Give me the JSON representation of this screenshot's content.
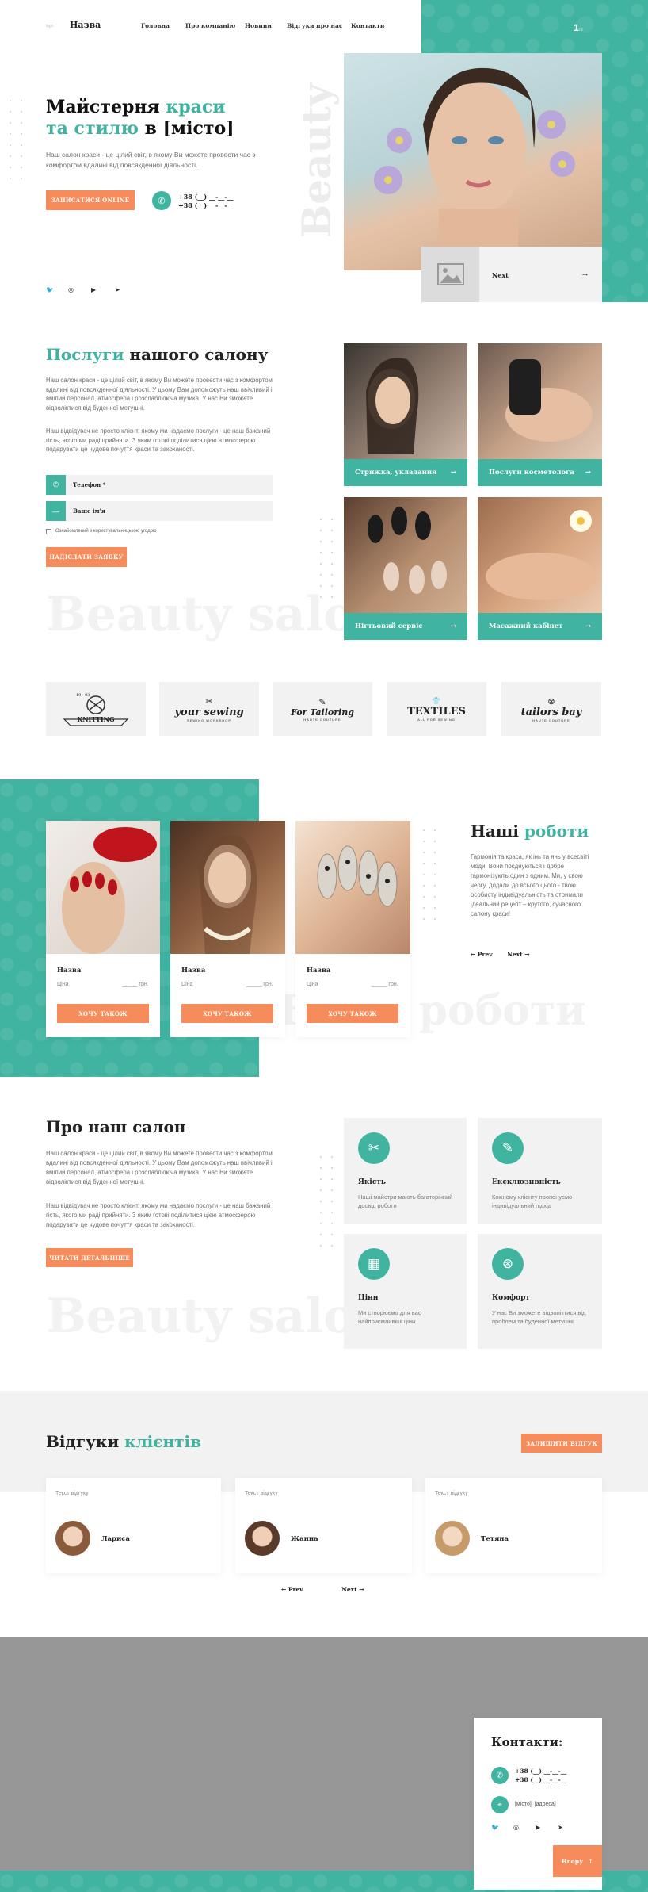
{
  "header": {
    "logo_label": "logo",
    "brand": "Назва",
    "nav": [
      "Головна",
      "Про компанію",
      "Новини",
      "Відгуки про нас",
      "Контакти"
    ],
    "page_indicator": "1",
    "page_indicator_small": "/3"
  },
  "hero": {
    "title_part1": "Майстерня ",
    "title_accent": "краси та стилю",
    "title_part2": " в [місто]",
    "text": "Наш салон краси - це цілий світ, в якому Ви можете провести час з комфортом вдалині від повсякденної діяльності.",
    "cta": "Записатися Online",
    "phone1": "+38 (__) __-__-__",
    "phone2": "+38 (__) __-__-__",
    "vertical_word": "Beauty",
    "next_label": "Next"
  },
  "socials": [
    "twitter-icon",
    "instagram-icon",
    "youtube-icon",
    "telegram-icon"
  ],
  "services": {
    "title_accent": "Послуги",
    "title_rest": " нашого салону",
    "text1": "Наш салон краси - це цілий світ, в якому Ви можете провести час з комфортом вдалині від повсякденної діяльності. У цьому Вам допоможуть наш ввічливий і вмілий персонал, атмосфера і розслаблююча музика. У нас Ви зможете відволіктися від буденної метушні.",
    "text2": "Наш відвідувач не просто клієнт, якому ми надаємо послуги - це наш бажаний гість, якого ми раді прийняти. З яким готові поділитися цією атмосферою подарувати це чудове почуття краси та закоханості.",
    "phone_placeholder": "Телефон *",
    "name_placeholder": "Ваше ім'я",
    "consent": "Ознайомлений з користувальницькою угодою",
    "submit": "Надіслати заявку",
    "ghost": "Beauty saloon",
    "cards": [
      "Стрижка, укладання",
      "Послуги косметолога",
      "Нігтьовий сервіс",
      "Масажний кабінет"
    ]
  },
  "partners": [
    {
      "top": "19 · 93",
      "name": "KNITTING"
    },
    {
      "top": "",
      "name": "your sewing",
      "sub": "SEWING WORKSHOP"
    },
    {
      "top": "",
      "name": "For Tailoring",
      "sub": "HAUTE COUTURE"
    },
    {
      "top": "",
      "name": "TEXTILES",
      "sub": "ALL FOR SEWING"
    },
    {
      "top": "",
      "name": "tailors bay",
      "sub": "HAUTE COUTURE"
    }
  ],
  "works": {
    "title_part1": "Наші ",
    "title_accent": "роботи",
    "text": "Гармонія та краса, як інь та янь у всесвіті моди. Вони поєднуються і добре гармонізують один з одним. Ми, у свою чергу, додали до всього цього - твою особисту індивідуальність та отримали ідеальний рецепт – крутого, сучасного салону краси!",
    "prev": "Prev",
    "next": "Next",
    "ghost": "Наші роботи",
    "items": [
      {
        "name": "Назва",
        "price_label": "Ціна",
        "price": "_____ грн.",
        "cta": "Хочу також"
      },
      {
        "name": "Назва",
        "price_label": "Ціна",
        "price": "_____ грн.",
        "cta": "Хочу також"
      },
      {
        "name": "Назва",
        "price_label": "Ціна",
        "price": "_____ грн.",
        "cta": "Хочу також"
      }
    ]
  },
  "about": {
    "title": "Про наш салон",
    "text1": "Наш салон краси - це цілий світ, в якому Ви можете провести час з комфортом вдалині від повсякденної діяльності. У цьому Вам допоможуть наш ввічливий і вмілий персонал, атмосфера і розслаблююча музика. У нас Ви зможете відволіктися від буденної метушні.",
    "text2": "Наш відвідувач не просто клієнт, якому ми надаємо послуги - це наш бажаний гість, якого ми раді прийняти. З яким готові поділитися цією атмосферою подарувати це чудове почуття краси та закоханості.",
    "cta": "Читати детальніше",
    "ghost": "Beauty saloon",
    "features": [
      {
        "title": "Якість",
        "text": "Наші майстри мають багаторічний досвід роботи",
        "icon": "scissors-icon"
      },
      {
        "title": "Ексклюзивність",
        "text": "Кожному клієнту пропонуємо індивідуальний підхід",
        "icon": "needle-icon"
      },
      {
        "title": "Ціни",
        "text": "Ми створюємо для вас найприємливіші ціни",
        "icon": "calculator-icon"
      },
      {
        "title": "Комфорт",
        "text": "У нас Ви зможете відволіктися від проблем та буденної метушні",
        "icon": "thread-icon"
      }
    ]
  },
  "reviews": {
    "title_part1": "Відгуки ",
    "title_accent": "клієнтів",
    "cta": "Залишити відгук",
    "items": [
      {
        "text": "Текст відгуку",
        "name": "Лариса"
      },
      {
        "text": "Текст відгуку",
        "name": "Жанна"
      },
      {
        "text": "Текст відгуку",
        "name": "Тетяна"
      }
    ],
    "prev": "Prev",
    "next": "Next"
  },
  "contacts": {
    "title": "Контакти:",
    "phone1": "+38 (__) __-__-__",
    "phone2": "+38 (__) __-__-__",
    "address": "[місто], [адреса]",
    "up": "Вгору"
  },
  "colors": {
    "accent": "#41b3a1",
    "cta": "#f68b5b",
    "map": "#979797"
  }
}
